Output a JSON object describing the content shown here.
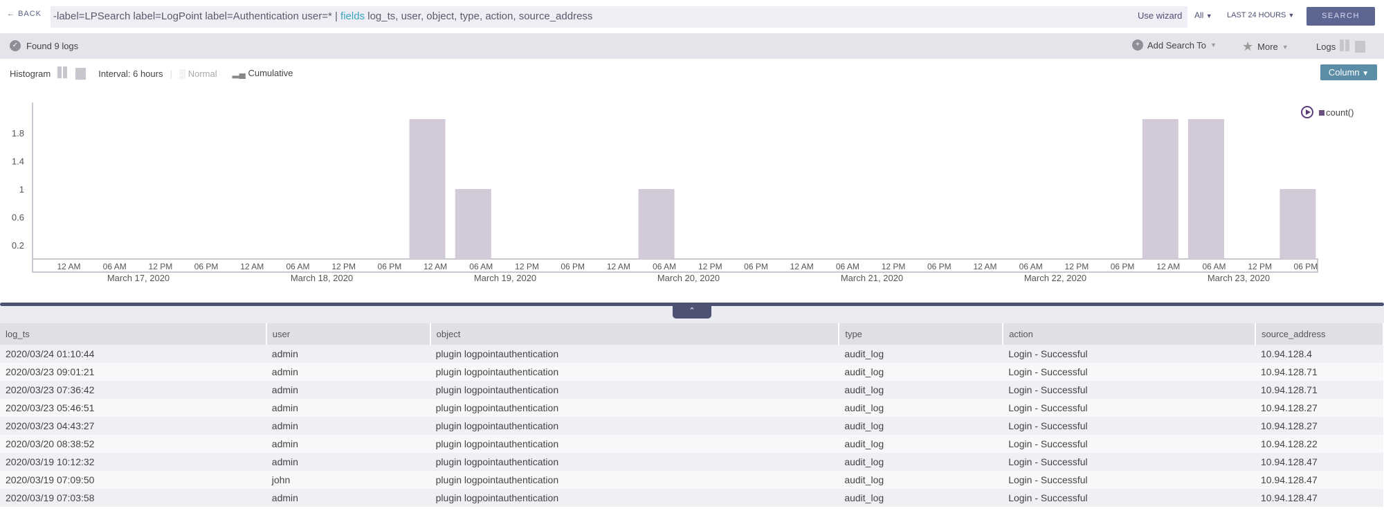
{
  "topbar": {
    "back_label": "BACK",
    "query_prefix": "-label=LPSearch label=LogPoint label=Authentication user=* | ",
    "query_keyword": "fields",
    "query_suffix": " log_ts, user, object, type, action, source_address",
    "wizard": "Use wizard",
    "repo_select": "All",
    "time_select": "LAST 24 HOURS",
    "search_button": "SEARCH"
  },
  "status": {
    "found": "Found 9 logs",
    "add_search": "Add Search To",
    "more": "More",
    "logs": "Logs"
  },
  "histogram": {
    "label": "Histogram",
    "interval": "Interval: 6 hours",
    "normal": "Normal",
    "cumulative": "Cumulative",
    "column_button": "Column"
  },
  "colors": {
    "bar": "#d2cad9",
    "accent": "#5d6593",
    "legend": "#6a4f82"
  },
  "chart_data": {
    "type": "bar",
    "categories": [
      "12 AM",
      "06 AM",
      "12 PM",
      "06 PM",
      "12 AM",
      "06 AM",
      "12 PM",
      "06 PM",
      "12 AM",
      "06 AM",
      "12 PM",
      "06 PM",
      "12 AM",
      "06 AM",
      "12 PM",
      "06 PM",
      "12 AM",
      "06 AM",
      "12 PM",
      "06 PM",
      "12 AM",
      "06 AM",
      "12 PM",
      "06 PM",
      "12 AM",
      "06 AM",
      "12 PM",
      "06 PM"
    ],
    "dates": [
      "March 17, 2020",
      "March 18, 2020",
      "March 19, 2020",
      "March 20, 2020",
      "March 21, 2020",
      "March 22, 2020",
      "March 23, 2020"
    ],
    "series": [
      {
        "name": "count()",
        "values": [
          0,
          0,
          0,
          0,
          0,
          0,
          0,
          0,
          2,
          1,
          0,
          0,
          0,
          1,
          0,
          0,
          0,
          0,
          0,
          0,
          0,
          0,
          0,
          0,
          2,
          2,
          0,
          1
        ]
      }
    ],
    "yticks": [
      "0.2",
      "0.6",
      "1",
      "1.4",
      "1.8"
    ],
    "ylim": [
      0,
      2.2
    ],
    "legend": "top-right"
  },
  "table": {
    "headers": [
      "log_ts",
      "user",
      "object",
      "type",
      "action",
      "source_address"
    ],
    "rows": [
      [
        "2020/03/24 01:10:44",
        "admin",
        "plugin logpointauthentication",
        "audit_log",
        "Login - Successful",
        "10.94.128.4"
      ],
      [
        "2020/03/23 09:01:21",
        "admin",
        "plugin logpointauthentication",
        "audit_log",
        "Login - Successful",
        "10.94.128.71"
      ],
      [
        "2020/03/23 07:36:42",
        "admin",
        "plugin logpointauthentication",
        "audit_log",
        "Login - Successful",
        "10.94.128.71"
      ],
      [
        "2020/03/23 05:46:51",
        "admin",
        "plugin logpointauthentication",
        "audit_log",
        "Login - Successful",
        "10.94.128.27"
      ],
      [
        "2020/03/23 04:43:27",
        "admin",
        "plugin logpointauthentication",
        "audit_log",
        "Login - Successful",
        "10.94.128.27"
      ],
      [
        "2020/03/20 08:38:52",
        "admin",
        "plugin logpointauthentication",
        "audit_log",
        "Login - Successful",
        "10.94.128.22"
      ],
      [
        "2020/03/19 10:12:32",
        "admin",
        "plugin logpointauthentication",
        "audit_log",
        "Login - Successful",
        "10.94.128.47"
      ],
      [
        "2020/03/19 07:09:50",
        "john",
        "plugin logpointauthentication",
        "audit_log",
        "Login - Successful",
        "10.94.128.47"
      ],
      [
        "2020/03/19 07:03:58",
        "admin",
        "plugin logpointauthentication",
        "audit_log",
        "Login - Successful",
        "10.94.128.47"
      ]
    ]
  }
}
